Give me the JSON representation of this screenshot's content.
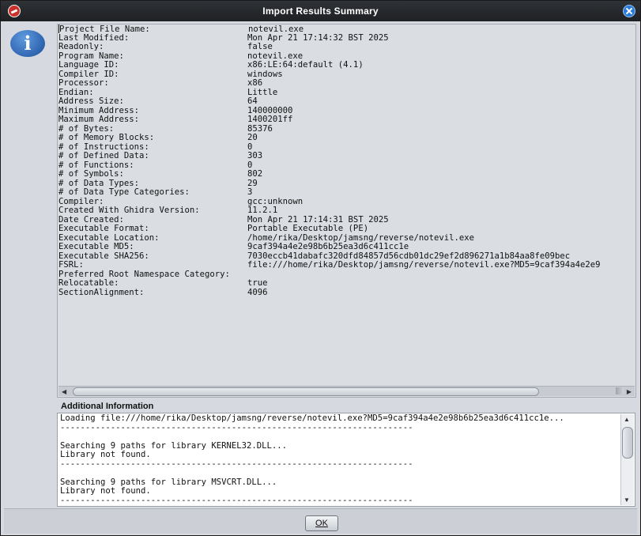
{
  "window": {
    "title": "Import Results Summary"
  },
  "summary": {
    "rows": [
      {
        "key": "Project File Name:",
        "value": "notevil.exe"
      },
      {
        "key": "Last Modified:",
        "value": "Mon Apr 21 17:14:32 BST 2025"
      },
      {
        "key": "Readonly:",
        "value": "false"
      },
      {
        "key": "Program Name:",
        "value": "notevil.exe"
      },
      {
        "key": "Language ID:",
        "value": "x86:LE:64:default (4.1)"
      },
      {
        "key": "Compiler ID:",
        "value": "windows"
      },
      {
        "key": "Processor:",
        "value": "x86"
      },
      {
        "key": "Endian:",
        "value": "Little"
      },
      {
        "key": "Address Size:",
        "value": "64"
      },
      {
        "key": "Minimum Address:",
        "value": "140000000"
      },
      {
        "key": "Maximum Address:",
        "value": "1400201ff"
      },
      {
        "key": "# of Bytes:",
        "value": "85376"
      },
      {
        "key": "# of Memory Blocks:",
        "value": "20"
      },
      {
        "key": "# of Instructions:",
        "value": "0"
      },
      {
        "key": "# of Defined Data:",
        "value": "303"
      },
      {
        "key": "# of Functions:",
        "value": "0"
      },
      {
        "key": "# of Symbols:",
        "value": "802"
      },
      {
        "key": "# of Data Types:",
        "value": "29"
      },
      {
        "key": "# of Data Type Categories:",
        "value": "3"
      },
      {
        "key": "Compiler:",
        "value": "gcc:unknown"
      },
      {
        "key": "Created With Ghidra Version:",
        "value": "11.2.1"
      },
      {
        "key": "Date Created:",
        "value": "Mon Apr 21 17:14:31 BST 2025"
      },
      {
        "key": "Executable Format:",
        "value": "Portable Executable (PE)"
      },
      {
        "key": "Executable Location:",
        "value": "/home/rika/Desktop/jamsng/reverse/notevil.exe"
      },
      {
        "key": "Executable MD5:",
        "value": "9caf394a4e2e98b6b25ea3d6c411cc1e"
      },
      {
        "key": "Executable SHA256:",
        "value": "7030eccb41dabafc320dfd84857d56cdb01dc29ef2d896271a1b84aa8fe09bec"
      },
      {
        "key": "FSRL:",
        "value": "file:///home/rika/Desktop/jamsng/reverse/notevil.exe?MD5=9caf394a4e2e9"
      },
      {
        "key": "Preferred Root Namespace Category:",
        "value": ""
      },
      {
        "key": "Relocatable:",
        "value": "true"
      },
      {
        "key": "SectionAlignment:",
        "value": "4096"
      }
    ]
  },
  "additional": {
    "label": "Additional Information",
    "lines": [
      "Loading file:///home/rika/Desktop/jamsng/reverse/notevil.exe?MD5=9caf394a4e2e98b6b25ea3d6c411cc1e...",
      "----------------------------------------------------------------------",
      "",
      "Searching 9 paths for library KERNEL32.DLL...",
      "Library not found.",
      "----------------------------------------------------------------------",
      "",
      "Searching 9 paths for library MSVCRT.DLL...",
      "Library not found.",
      "----------------------------------------------------------------------"
    ]
  },
  "footer": {
    "ok_label": "OK"
  },
  "icons": {
    "app": "ghidra-icon",
    "close": "close-icon",
    "info": "info-icon"
  }
}
